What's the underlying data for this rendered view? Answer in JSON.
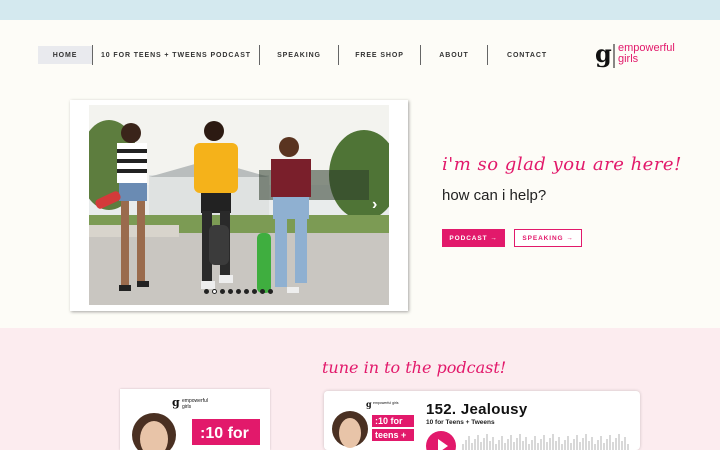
{
  "nav": {
    "items": [
      {
        "label": "HOME"
      },
      {
        "label": "10 FOR TEENS + TWEENS PODCAST"
      },
      {
        "label": "SPEAKING"
      },
      {
        "label": "FREE SHOP"
      },
      {
        "label": "ABOUT"
      },
      {
        "label": "CONTACT"
      }
    ]
  },
  "logo": {
    "line1": "empowerful",
    "line2": "girls",
    "mark": "g"
  },
  "hero": {
    "tagline": "i'm so glad you are here!",
    "question": "how can i help?",
    "podcast_button": "PODCAST →",
    "speaking_button": "SPEAKING →",
    "carousel_next_icon": "chevron-right-icon",
    "carousel_slide_count": 9,
    "carousel_active_index": 1
  },
  "podcast_section": {
    "heading": "tune in to the podcast!",
    "cover_left": {
      "brand": "empowerful girls",
      "title": ":10 for"
    },
    "player": {
      "cover_brand": "empowerful girls",
      "cover_title": ":10 for teens +",
      "episode_title": "152. Jealousy",
      "show_name": "10 for Teens + Tweens"
    }
  },
  "colors": {
    "accent": "#e2196b",
    "topbar": "#d4e9ef",
    "section_bg": "#fcecef",
    "page_bg": "#fdfcf7"
  }
}
